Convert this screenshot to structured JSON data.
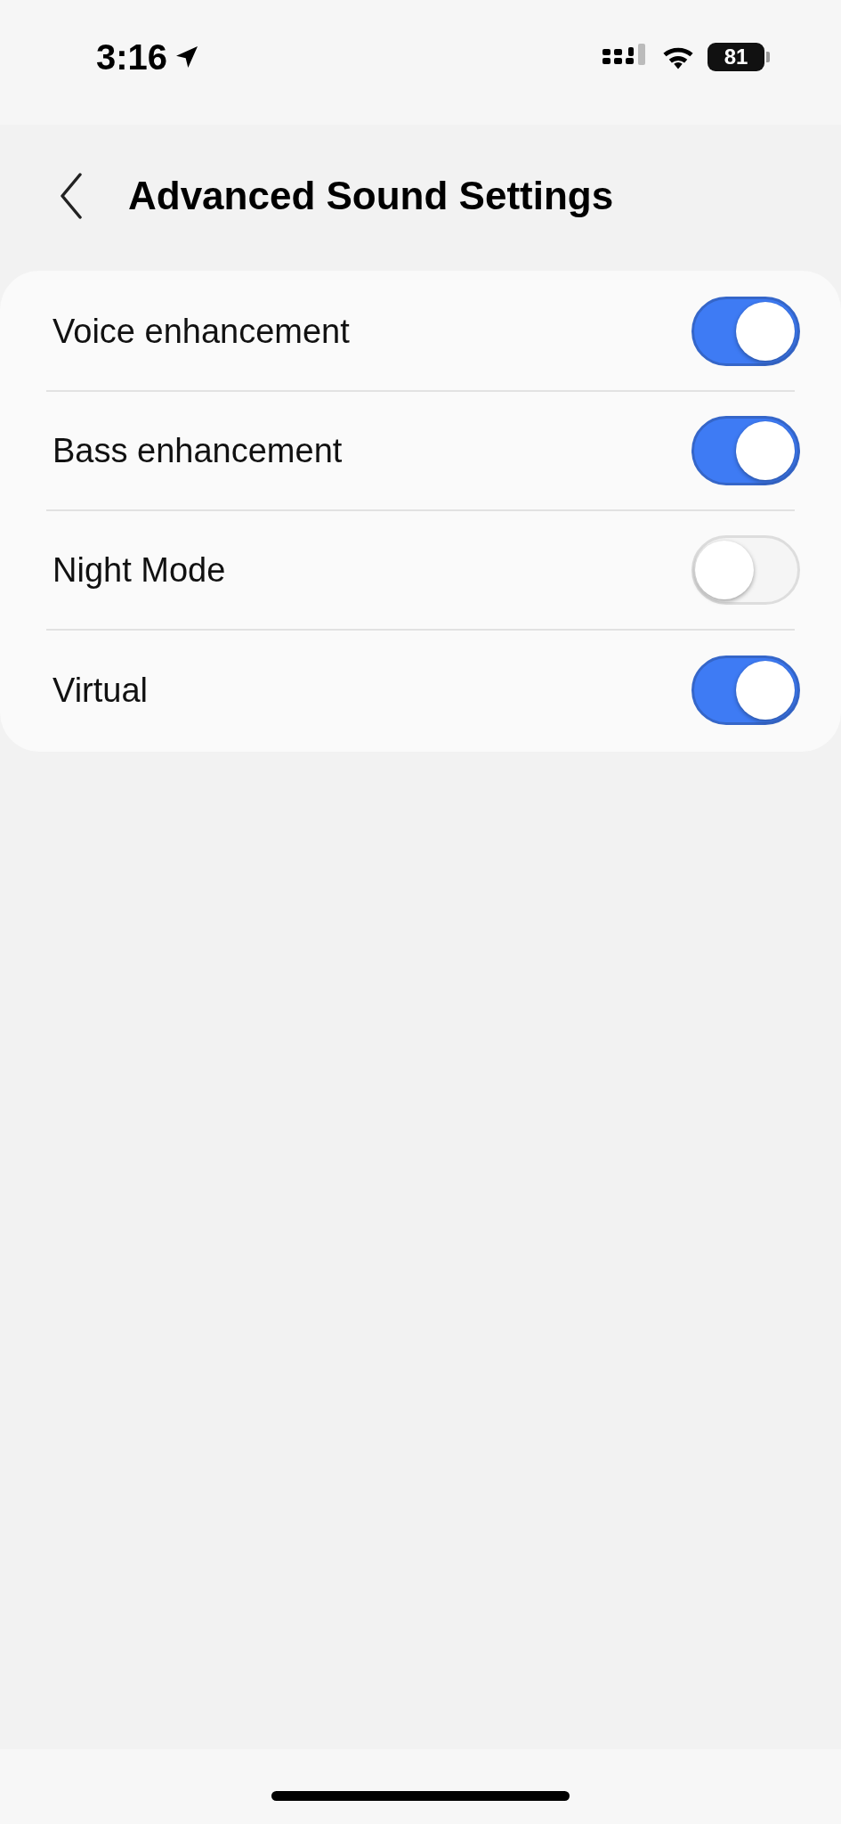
{
  "status_bar": {
    "time": "3:16",
    "battery": "81"
  },
  "header": {
    "title": "Advanced Sound Settings"
  },
  "settings": [
    {
      "label": "Voice enhancement",
      "on": true
    },
    {
      "label": "Bass enhancement",
      "on": true
    },
    {
      "label": "Night Mode",
      "on": false
    },
    {
      "label": "Virtual",
      "on": true
    }
  ]
}
